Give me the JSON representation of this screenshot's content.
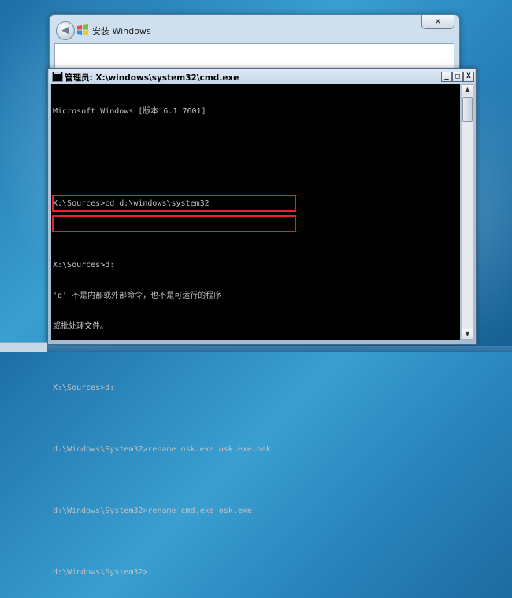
{
  "setup_window": {
    "title": "安装 Windows",
    "close_label": "✕"
  },
  "cmd_window": {
    "title": "管理员: X:\\windows\\system32\\cmd.exe",
    "minimize_label": "_",
    "maximize_label": "□",
    "close_label": "X",
    "lines": [
      "Microsoft Windows [版本 6.1.7601]",
      "",
      "",
      "X:\\Sources>cd d:\\windows\\system32",
      "",
      "X:\\Sources>d:",
      "'d' 不是内部或外部命令，也不是可运行的程序",
      "或批处理文件。",
      "",
      "X:\\Sources>d:",
      "",
      "d:\\Windows\\System32>rename osk.exe osk.exe.bak",
      "",
      "d:\\Windows\\System32>rename cmd.exe osk.exe",
      "",
      "d:\\Windows\\System32>"
    ]
  },
  "colors": {
    "console_bg": "#000000",
    "console_text": "#c0c0c0",
    "highlight": "#e8212a"
  }
}
